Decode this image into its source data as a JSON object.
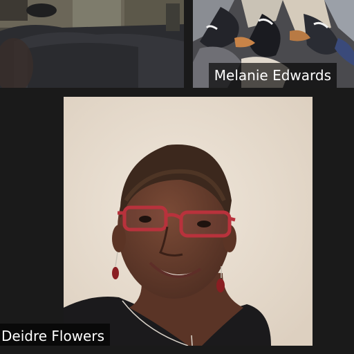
{
  "participants": [
    {
      "name": ""
    },
    {
      "name": "Melanie Edwards"
    },
    {
      "name": "Deidre Flowers"
    }
  ],
  "colors": {
    "background": "#1a1a1a",
    "name_tag_bg": "#000000",
    "name_tag_text": "#ffffff",
    "wall": "#e9dfd3",
    "glasses": "#b8323c"
  },
  "icons": {
    "speaker_video": "person-video",
    "top_left_video": "sofa-video",
    "top_right_video": "patterned-fabric-video"
  }
}
